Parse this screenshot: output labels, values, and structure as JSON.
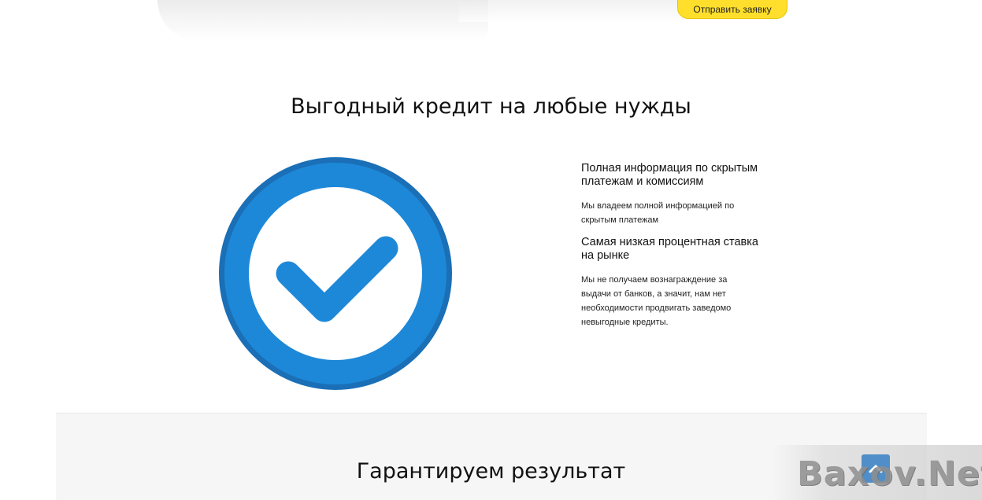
{
  "header": {
    "cta_label": "Отправить заявку"
  },
  "section1": {
    "title": "Выгодный кредит на любые нужды",
    "icon": "check-circle-icon",
    "features": [
      {
        "title_line1": "Полная информация по скрытым",
        "title_line2": "платежам и комиссиям",
        "text_line1": "Мы владеем полной информацией по",
        "text_line2": "скрытым платежам"
      },
      {
        "title_line1": "Самая низкая процентная ставка",
        "title_line2": "на рынке",
        "text_line1": "Мы не получаем вознаграждение за",
        "text_line2": "выдачи от банков, а значит, нам нет",
        "text_line3": "необходимости продвигать заведомо",
        "text_line4": "невыгодные кредиты."
      }
    ]
  },
  "section2": {
    "title": "Гарантируем результат"
  },
  "scroll_top": {
    "icon": "chevron-up-icon"
  },
  "watermark": {
    "text": "Baxov.Net"
  },
  "colors": {
    "accent_yellow": "#ffdf2b",
    "check_blue": "#1e88d8",
    "check_ring_dark": "#1a6fb6",
    "band_grey": "#f6f6f6"
  }
}
